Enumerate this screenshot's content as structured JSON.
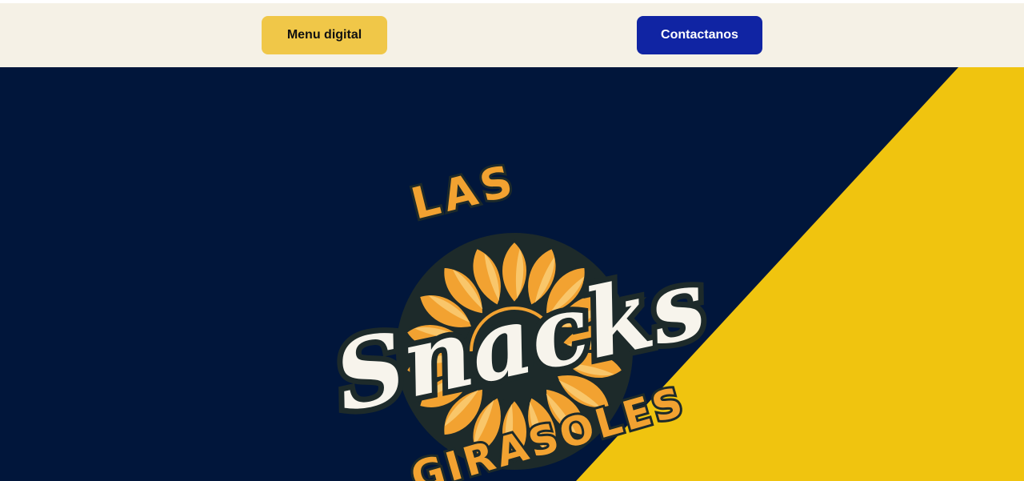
{
  "header": {
    "menu_button_label": "Menu digital",
    "contact_button_label": "Contactanos"
  },
  "logo": {
    "top_word": "LAS",
    "main_word": "Snacks",
    "bottom_word": "GIRASOLES",
    "icon": "sunflower-icon"
  },
  "colors": {
    "topbar_bg": "#f5f1e6",
    "menu_button": "#f0c748",
    "contact_button": "#1024a3",
    "hero_navy": "#01163b",
    "hero_yellow": "#f0c40f",
    "petal_orange": "#f2a231",
    "logo_outline": "#1d2a2a"
  }
}
